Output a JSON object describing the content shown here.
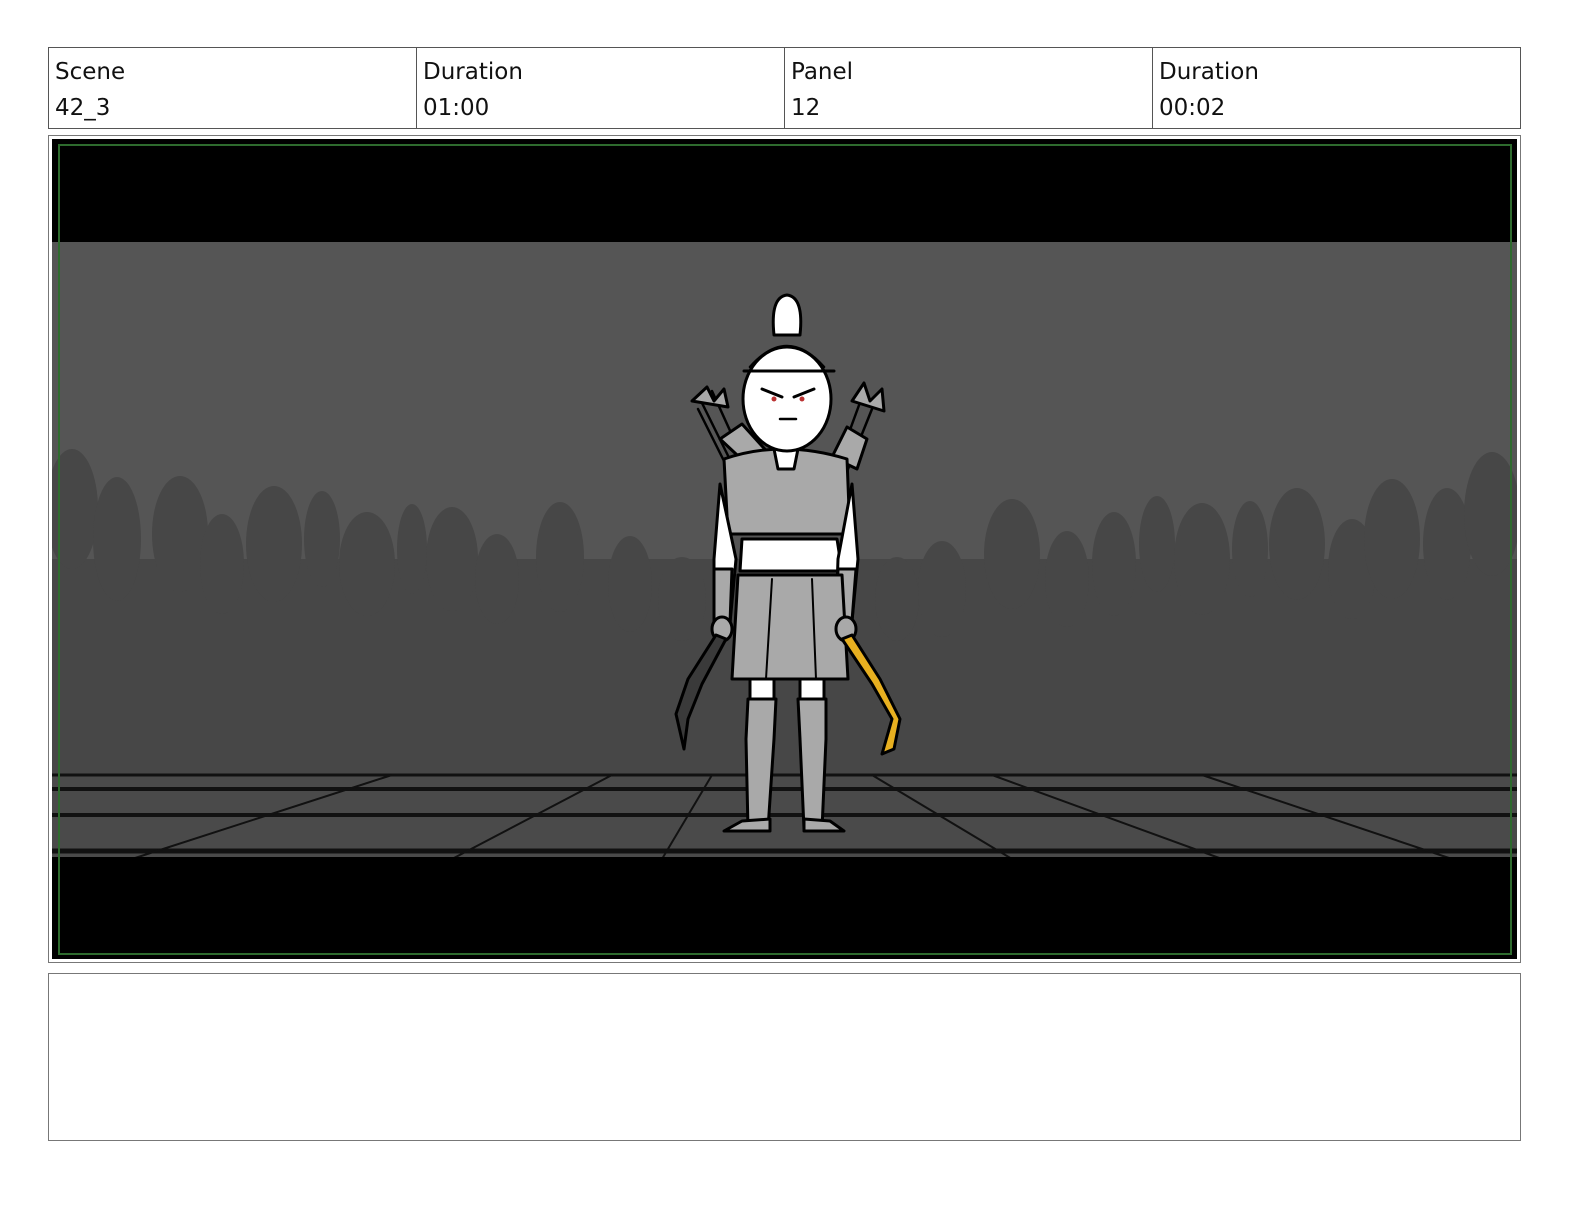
{
  "header": {
    "scene_label": "Scene",
    "scene_value": "42_3",
    "scene_duration_label": "Duration",
    "scene_duration_value": "01:00",
    "panel_label": "Panel",
    "panel_value": "12",
    "panel_duration_label": "Duration",
    "panel_duration_value": "00:02"
  },
  "panel": {
    "colors": {
      "letterbox": "#000000",
      "backdrop": "#555555",
      "crowd": "#474747",
      "floor": "#4a4a4a",
      "safe_area": "#2e6b2e",
      "character_fill": "#a9a9a9",
      "weapon_accent": "#e8b020"
    }
  },
  "notes": {
    "text": ""
  }
}
